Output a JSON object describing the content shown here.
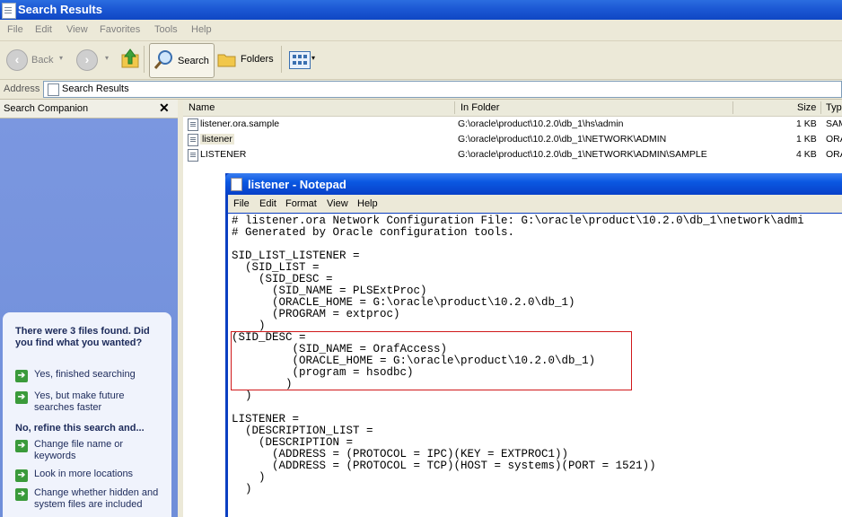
{
  "window": {
    "title": "Search Results",
    "icon": "search-results-icon"
  },
  "menubar": {
    "items": [
      "File",
      "Edit",
      "View",
      "Favorites",
      "Tools",
      "Help"
    ]
  },
  "toolbar": {
    "back_label": "Back",
    "search_label": "Search",
    "folders_label": "Folders"
  },
  "address": {
    "label": "Address",
    "value": "Search Results"
  },
  "companion": {
    "title": "Search Companion",
    "close": "✕",
    "question": "There were 3 files found. Did you find what you wanted?",
    "options": [
      "Yes, finished searching",
      "Yes, but make future searches faster"
    ],
    "refine_heading": "No, refine this search and...",
    "refine_options": [
      "Change file name or keywords",
      "Look in more locations",
      "Change whether hidden and system files are included"
    ]
  },
  "filelist": {
    "columns": [
      "Name",
      "In Folder",
      "Size",
      "Typ"
    ],
    "rows": [
      {
        "name": "listener.ora.sample",
        "folder": "G:\\oracle\\product\\10.2.0\\db_1\\hs\\admin",
        "size": "1 KB",
        "type": "SAM"
      },
      {
        "name": "listener",
        "folder": "G:\\oracle\\product\\10.2.0\\db_1\\NETWORK\\ADMIN",
        "size": "1 KB",
        "type": "ORA"
      },
      {
        "name": "LISTENER",
        "folder": "G:\\oracle\\product\\10.2.0\\db_1\\NETWORK\\ADMIN\\SAMPLE",
        "size": "4 KB",
        "type": "ORA"
      }
    ]
  },
  "notepad": {
    "title": "listener - Notepad",
    "menu": [
      "File",
      "Edit",
      "Format",
      "View",
      "Help"
    ],
    "content": "# listener.ora Network Configuration File: G:\\oracle\\product\\10.2.0\\db_1\\network\\admi\n# Generated by Oracle configuration tools.\n\nSID_LIST_LISTENER =\n  (SID_LIST =\n    (SID_DESC =\n      (SID_NAME = PLSExtProc)\n      (ORACLE_HOME = G:\\oracle\\product\\10.2.0\\db_1)\n      (PROGRAM = extproc)\n    )\n(SID_DESC =\n         (SID_NAME = OrafAccess)\n         (ORACLE_HOME = G:\\oracle\\product\\10.2.0\\db_1)\n         (program = hsodbc)\n        )\n  )\n\nLISTENER =\n  (DESCRIPTION_LIST =\n    (DESCRIPTION =\n      (ADDRESS = (PROTOCOL = IPC)(KEY = EXTPROC1))\n      (ADDRESS = (PROTOCOL = TCP)(HOST = systems)(PORT = 1521))\n    )\n  )",
    "highlight_color": "#d0181a"
  }
}
